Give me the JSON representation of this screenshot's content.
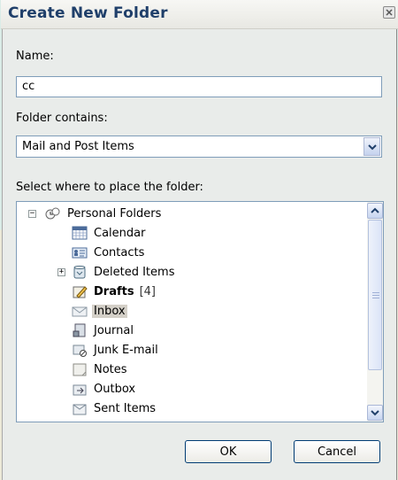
{
  "dialog": {
    "title": "Create New Folder",
    "name_label": "Name:",
    "name_value": "cc",
    "contains_label": "Folder contains:",
    "contains_value": "Mail and Post Items",
    "place_label": "Select where to place the folder:",
    "ok_label": "OK",
    "cancel_label": "Cancel"
  },
  "tree": {
    "root": "Personal Folders",
    "items": [
      {
        "label": "Calendar",
        "icon": "calendar-icon"
      },
      {
        "label": "Contacts",
        "icon": "contacts-icon"
      },
      {
        "label": "Deleted Items",
        "icon": "deleted-items-icon"
      },
      {
        "label": "Drafts",
        "icon": "drafts-icon",
        "count": "[4]"
      },
      {
        "label": "Inbox",
        "icon": "inbox-icon"
      },
      {
        "label": "Journal",
        "icon": "journal-icon"
      },
      {
        "label": "Junk E-mail",
        "icon": "junk-email-icon"
      },
      {
        "label": "Notes",
        "icon": "notes-icon"
      },
      {
        "label": "Outbox",
        "icon": "outbox-icon"
      },
      {
        "label": "Sent Items",
        "icon": "sent-items-icon"
      }
    ]
  },
  "colors": {
    "watermark": "#bfe3ea",
    "accent": "#1f3f6a",
    "selection": "#d4d0c8"
  }
}
